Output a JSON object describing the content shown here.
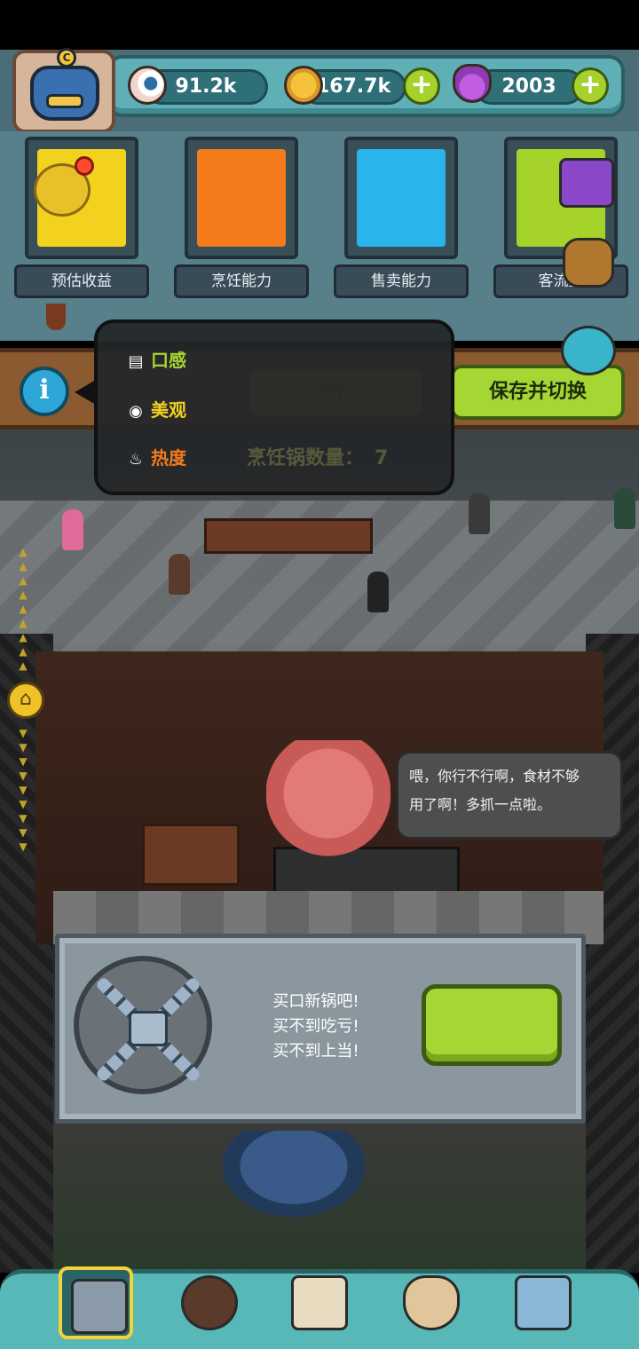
{
  "resources": {
    "eyeballs": "91.2k",
    "coins": "167.7k",
    "potions": "2003"
  },
  "stats": [
    {
      "label": "预估收益",
      "color": "#f3d21f"
    },
    {
      "label": "烹饪能力",
      "color": "#f57a1c"
    },
    {
      "label": "售卖能力",
      "color": "#2ab4ec"
    },
    {
      "label": "客流量",
      "color": "#a6d32a"
    }
  ],
  "action_bar": {
    "info_icon": "i",
    "save_label": "保存",
    "save_switch_label": "保存并切换"
  },
  "tooltip": {
    "taste_label": "口感",
    "looks_label": "美观",
    "heat_label": "热度",
    "pot_count_label": "烹饪锅数量：",
    "pot_count_value": "7"
  },
  "speech": {
    "line1": "喂，你行不行啊，食材不够",
    "line2": "用了啊！多抓一点啦。"
  },
  "unlock": {
    "line1": "买口新锅吧!",
    "line2": "买不到吃亏!",
    "line3": "买不到上当!"
  },
  "colors": {
    "accent_green": "#a6d634",
    "taste_color": "#a6d634",
    "looks_color": "#f3d21f",
    "heat_color": "#f57a1c"
  },
  "icons": {
    "resource_1": "eyeball-icon",
    "resource_2": "coin-icon",
    "resource_3": "potion-icon",
    "nav": [
      "restaurant-icon",
      "monster-icon",
      "book-icon",
      "money-bag-icon",
      "grid-menu-icon"
    ]
  }
}
